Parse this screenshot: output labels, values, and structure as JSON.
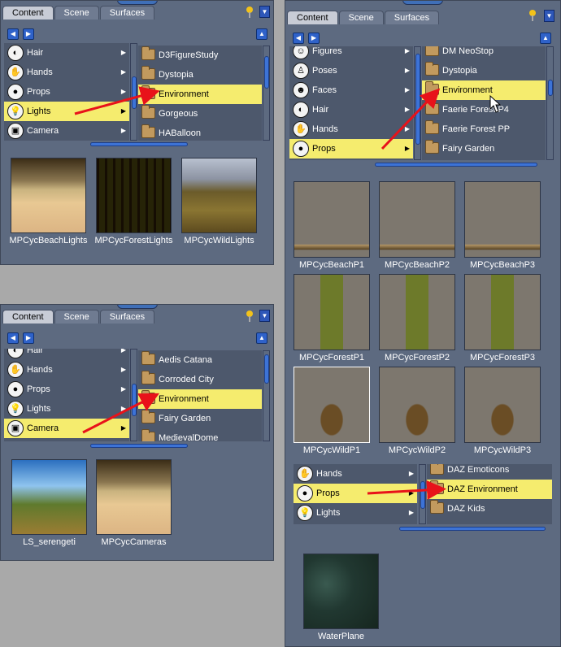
{
  "accent": "#3d73d6",
  "highlight": "#f5ec6e",
  "panels": [
    {
      "tabs": [
        "Content",
        "Scene",
        "Surfaces"
      ],
      "categories": [
        {
          "label": "Hair",
          "icon": "hair-icon",
          "glyph": "◐"
        },
        {
          "label": "Hands",
          "icon": "hands-icon",
          "glyph": "✋"
        },
        {
          "label": "Props",
          "icon": "props-icon",
          "glyph": "●"
        },
        {
          "label": "Lights",
          "icon": "lightbulb-icon",
          "glyph": "💡",
          "selected": true
        },
        {
          "label": "Camera",
          "icon": "camera-icon",
          "glyph": "▣"
        }
      ],
      "folders": [
        {
          "label": "D3FigureStudy"
        },
        {
          "label": "Dystopia"
        },
        {
          "label": "Environment",
          "selected": true
        },
        {
          "label": "Gorgeous"
        },
        {
          "label": "HABalloon"
        }
      ],
      "thumbs": [
        {
          "label": "MPCycBeachLights",
          "kind": "beach"
        },
        {
          "label": "MPCycForestLights",
          "kind": "forest"
        },
        {
          "label": "MPCycWildLights",
          "kind": "wild"
        }
      ]
    },
    {
      "tabs": [
        "Content",
        "Scene",
        "Surfaces"
      ],
      "categories": [
        {
          "label": "Hair",
          "icon": "hair-icon",
          "glyph": "◐"
        },
        {
          "label": "Hands",
          "icon": "hands-icon",
          "glyph": "✋"
        },
        {
          "label": "Props",
          "icon": "props-icon",
          "glyph": "●"
        },
        {
          "label": "Lights",
          "icon": "lightbulb-icon",
          "glyph": "💡"
        },
        {
          "label": "Camera",
          "icon": "camera-icon",
          "glyph": "▣",
          "selected": true
        }
      ],
      "folders": [
        {
          "label": "Aedis Catana"
        },
        {
          "label": "Corroded City"
        },
        {
          "label": "Environment",
          "selected": true
        },
        {
          "label": "Fairy Garden"
        },
        {
          "label": "MedievalDome"
        }
      ],
      "thumbs": [
        {
          "label": "LS_serengeti",
          "kind": "savanna"
        },
        {
          "label": "MPCycCameras",
          "kind": "beach"
        }
      ]
    },
    {
      "tabs": [
        "Content",
        "Scene",
        "Surfaces"
      ],
      "categories": [
        {
          "label": "Figures",
          "icon": "figures-icon",
          "glyph": "☺"
        },
        {
          "label": "Poses",
          "icon": "poses-icon",
          "glyph": "♙"
        },
        {
          "label": "Faces",
          "icon": "faces-icon",
          "glyph": "☻"
        },
        {
          "label": "Hair",
          "icon": "hair-icon",
          "glyph": "◐"
        },
        {
          "label": "Hands",
          "icon": "hands-icon",
          "glyph": "✋"
        },
        {
          "label": "Props",
          "icon": "props-icon",
          "glyph": "●",
          "selected": true
        }
      ],
      "folders": [
        {
          "label": "DM NeoStop"
        },
        {
          "label": "Dystopia"
        },
        {
          "label": "Environment",
          "selected": true
        },
        {
          "label": "Faerie Forest P4"
        },
        {
          "label": "Faerie Forest PP"
        },
        {
          "label": "Fairy Garden"
        }
      ],
      "thumbs": [
        {
          "label": "MPCycBeachP1",
          "kind": "prop-beach"
        },
        {
          "label": "MPCycBeachP2",
          "kind": "prop-beach"
        },
        {
          "label": "MPCycBeachP3",
          "kind": "prop-beach"
        },
        {
          "label": "MPCycForestP1",
          "kind": "prop-forest"
        },
        {
          "label": "MPCycForestP2",
          "kind": "prop-forest"
        },
        {
          "label": "MPCycForestP3",
          "kind": "prop-forest"
        },
        {
          "label": "MPCycWildP1",
          "kind": "prop-wild"
        },
        {
          "label": "MPCycWildP2",
          "kind": "prop-wild"
        },
        {
          "label": "MPCycWildP3",
          "kind": "prop-wild"
        }
      ],
      "lower_categories": [
        {
          "label": "Hands",
          "icon": "hands-icon",
          "glyph": "✋"
        },
        {
          "label": "Props",
          "icon": "props-icon",
          "glyph": "●",
          "selected": true
        },
        {
          "label": "Lights",
          "icon": "lightbulb-icon",
          "glyph": "💡"
        }
      ],
      "lower_folders": [
        {
          "label": "DAZ Emoticons"
        },
        {
          "label": "DAZ Environment",
          "selected": true
        },
        {
          "label": "DAZ Kids"
        }
      ],
      "lower_thumbs": [
        {
          "label": "WaterPlane",
          "kind": "water"
        }
      ]
    }
  ]
}
